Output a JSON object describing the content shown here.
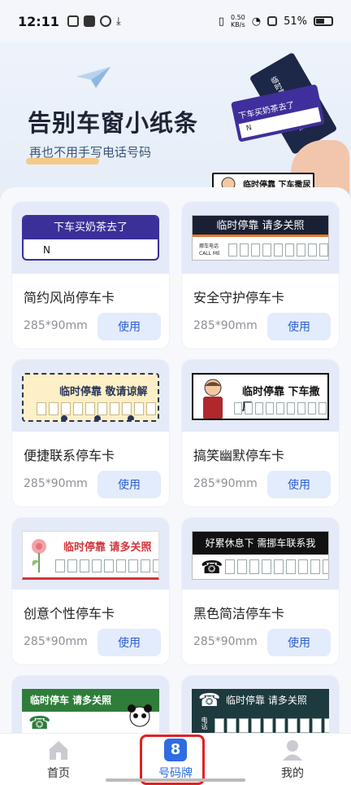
{
  "status_bar": {
    "time": "12:11",
    "net_speed_value": "0.50",
    "net_speed_unit": "KB/s",
    "battery": "51%"
  },
  "hero": {
    "title": "告别车窗小纸条",
    "subtitle": "再也不用手写电话号码",
    "art_card_purple": "下车买奶茶去了",
    "art_card_purple_sub": "N",
    "art_card_funny": "临时停靠 下车撒尿",
    "art_card_navy": "临时停靠 请多关照",
    "art_card_navy_sub": "CALL ME"
  },
  "cards": [
    {
      "name": "简约风尚停车卡",
      "size": "285*90mm",
      "button": "使用",
      "preview_text": "下车买奶茶去了",
      "preview_sub": "N"
    },
    {
      "name": "安全守护停车卡",
      "size": "285*90mm",
      "button": "使用",
      "preview_text": "临时停靠 请多关照",
      "preview_sub1": "挪车电话",
      "preview_sub2": "CALL ME"
    },
    {
      "name": "便捷联系停车卡",
      "size": "285*90mm",
      "button": "使用",
      "preview_text": "临时停靠 敬请谅解"
    },
    {
      "name": "搞笑幽默停车卡",
      "size": "285*90mm",
      "button": "使用",
      "preview_text": "临时停靠 下车撒尿"
    },
    {
      "name": "创意个性停车卡",
      "size": "285*90mm",
      "button": "使用",
      "preview_text": "临时停靠 请多关照"
    },
    {
      "name": "黑色简洁停车卡",
      "size": "285*90mm",
      "button": "使用",
      "preview_text": "好累休息下 需挪车联系我"
    },
    {
      "name": "",
      "size": "",
      "button": "",
      "preview_text": "临时停车 请多关照"
    },
    {
      "name": "",
      "size": "",
      "button": "",
      "preview_text": "临时停靠 请多关照",
      "preview_sub": "电话"
    }
  ],
  "tabbar": {
    "home": "首页",
    "plate": "号码牌",
    "plate_badge": "8",
    "mine": "我的"
  },
  "colors": {
    "accent": "#2d6de0",
    "highlight": "#e02222"
  }
}
